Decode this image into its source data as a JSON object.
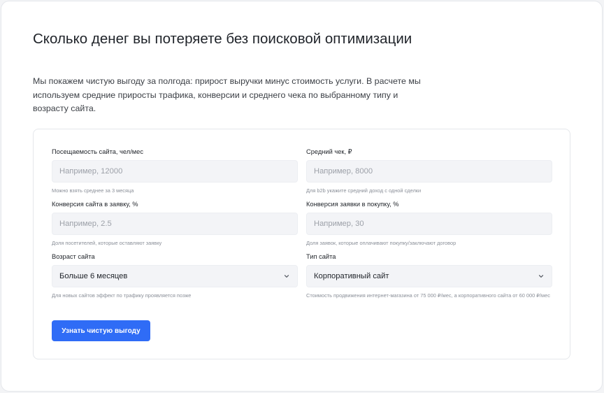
{
  "header": {
    "title": "Сколько денег вы потеряете без поисковой оптимизации",
    "lead": "Мы покажем чистую выгоду за полгода: прирост выручки минус стоимость услуги. В расчете мы используем средние приросты трафика, конверсии и среднего чека по выбранному типу и возрасту сайта."
  },
  "form": {
    "traffic": {
      "label": "Посещаемость сайта, чел/мес",
      "placeholder": "Например, 12000",
      "value": "",
      "hint": "Можно взять среднее за 3 месяца"
    },
    "avg_check": {
      "label": "Средний чек, ₽",
      "placeholder": "Например, 8000",
      "value": "",
      "hint": "Для b2b укажите средний доход с одной сделки"
    },
    "conversion_site": {
      "label": "Конверсия сайта в заявку, %",
      "placeholder": "Например, 2.5",
      "value": "",
      "hint": "Доля посетителей, которые оставляют заявку"
    },
    "conversion_purchase": {
      "label": "Конверсия заявки в покупку, %",
      "placeholder": "Например, 30",
      "value": "",
      "hint": "Доля заявок, которые оплачивают покупку/заключают договор"
    },
    "site_age": {
      "label": "Возраст сайта",
      "selected": "Больше 6 месяцев",
      "hint": "Для новых сайтов эффект по трафику проявляется позже",
      "icon": "chevron-down-icon"
    },
    "site_type": {
      "label": "Тип сайта",
      "selected": "Корпоративный сайт",
      "hint": "Стоимость продвижения интернет-магазина от 75 000 ₽/мес, а корпоративного сайта от 60 000 ₽/мес",
      "icon": "chevron-down-icon"
    },
    "submit_label": "Узнать чистую выгоду"
  },
  "colors": {
    "accent": "#2f6cf6",
    "input_bg": "#f3f4f7",
    "hint": "#8a8f98"
  }
}
